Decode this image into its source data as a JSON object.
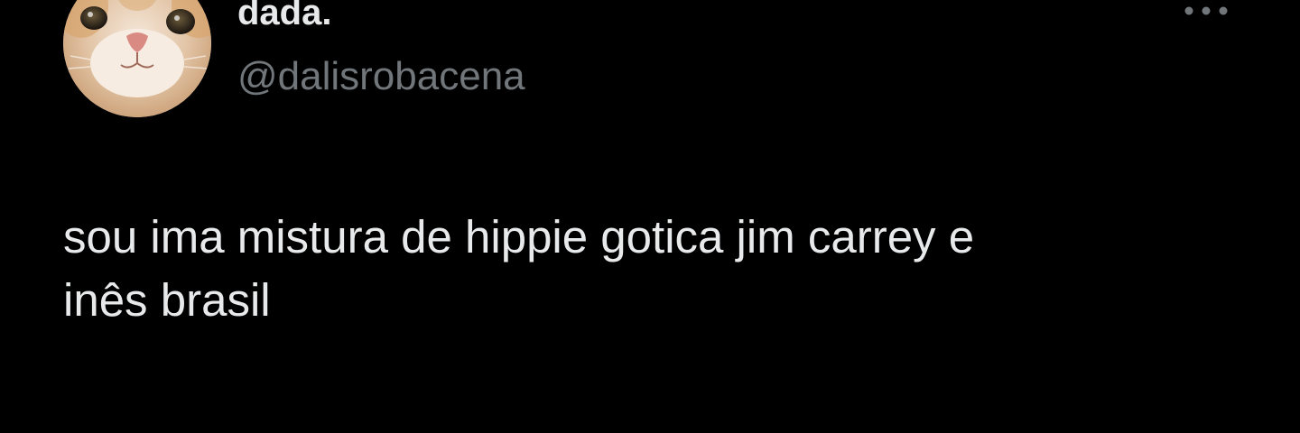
{
  "tweet": {
    "display_name": "dada.",
    "handle": "@dalisrobacena",
    "text": "sou ima mistura de hippie gotica jim carrey e\ninês brasil",
    "avatar_icon": "cat-face-avatar",
    "more_icon": "more-options-icon"
  },
  "colors": {
    "background": "#000000",
    "primary_text": "#e7e9ea",
    "secondary_text": "#71767b"
  }
}
